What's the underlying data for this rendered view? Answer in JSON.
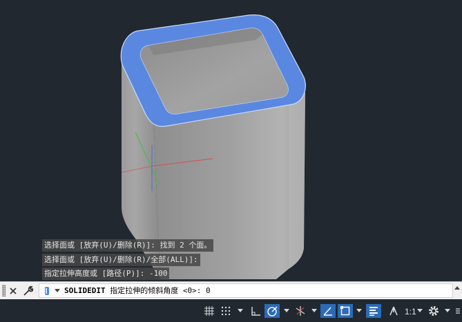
{
  "command_history": [
    "选择面或 [放弃(U)/删除(R)]: 找到 2 个面。",
    "选择面或 [放弃(U)/删除(R)/全部(ALL)]:",
    "指定拉伸高度或 [路径(P)]: -100"
  ],
  "command_line": {
    "command": "SOLIDEDIT",
    "prompt": "指定拉伸的倾斜角度 <0>: 0"
  },
  "status_bar": {
    "scale": "1:1"
  },
  "colors": {
    "viewport_bg": "#212830",
    "selection_highlight": "#5a88e0",
    "active_toggle": "#2c6bb8"
  },
  "icons": {
    "close": "close-icon",
    "customize": "wrench-icon",
    "command": "command-prompt-icon",
    "grid": "grid-icon",
    "snap": "snap-grid-icon",
    "ortho": "ortho-icon",
    "polar": "polar-tracking-icon",
    "isodraft": "isometric-icon",
    "dynamic_ucs": "dynamic-ucs-icon",
    "osnap": "object-snap-icon",
    "lineweight": "lineweight-icon",
    "annotation": "annotation-scale-icon",
    "settings": "gear-icon"
  }
}
